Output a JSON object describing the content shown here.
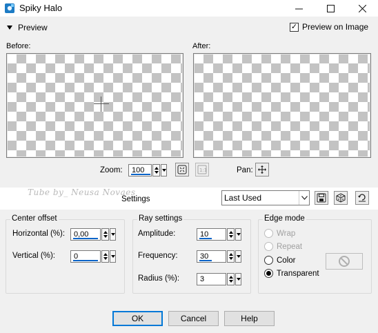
{
  "window": {
    "title": "Spiky Halo",
    "minimize": "—",
    "maximize": "☐",
    "close": "✕"
  },
  "preview": {
    "toggle_label": "Preview",
    "preview_on_image_label": "Preview on Image",
    "preview_on_image_checked": true,
    "before_label": "Before:",
    "after_label": "After:"
  },
  "zoom": {
    "label": "Zoom:",
    "value": "100",
    "pan_label": "Pan:"
  },
  "settings": {
    "watermark": "Tube by_  Neusa Novaes",
    "label": "Settings",
    "preset_value": "Last Used"
  },
  "center_offset": {
    "title": "Center offset",
    "horizontal_label": "Horizontal (%):",
    "horizontal_value": "0,00",
    "vertical_label": "Vertical (%):",
    "vertical_value": "0"
  },
  "ray_settings": {
    "title": "Ray settings",
    "amplitude_label": "Amplitude:",
    "amplitude_value": "10",
    "frequency_label": "Frequency:",
    "frequency_value": "30",
    "radius_label": "Radius (%):",
    "radius_value": "3"
  },
  "edge_mode": {
    "title": "Edge mode",
    "options": [
      {
        "label": "Wrap",
        "selected": false,
        "enabled": false
      },
      {
        "label": "Repeat",
        "selected": false,
        "enabled": false
      },
      {
        "label": "Color",
        "selected": false,
        "enabled": true
      },
      {
        "label": "Transparent",
        "selected": true,
        "enabled": true
      }
    ]
  },
  "buttons": {
    "ok": "OK",
    "cancel": "Cancel",
    "help": "Help"
  },
  "colors": {
    "accent": "#0078d7",
    "checker_dark": "#c3c3c3",
    "checker_light": "#ffffff",
    "dialog_bg": "#f0f0f0"
  }
}
